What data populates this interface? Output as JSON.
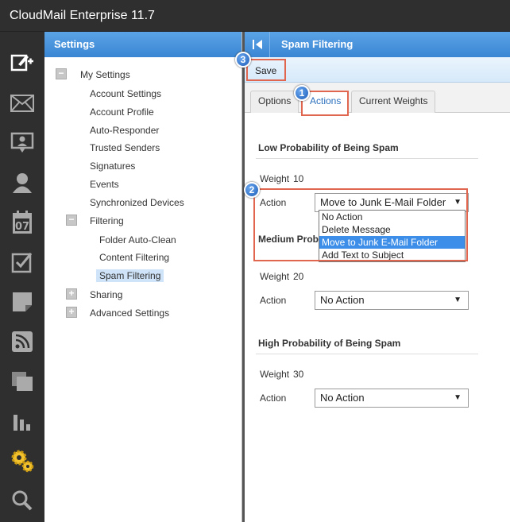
{
  "app": {
    "title": "CloudMail Enterprise 11.7"
  },
  "iconbar": {
    "icons": [
      "compose-icon",
      "mail-icon",
      "contacts-card-icon",
      "user-icon",
      "calendar-icon",
      "tasks-icon",
      "notes-icon",
      "rss-icon",
      "files-icon",
      "reports-icon",
      "settings-gear-icon",
      "search-icon"
    ],
    "calendar_day": "07"
  },
  "settings": {
    "header": "Settings",
    "tree": {
      "my_settings": "My Settings",
      "account_settings": "Account Settings",
      "account_profile": "Account Profile",
      "auto_responder": "Auto-Responder",
      "trusted_senders": "Trusted Senders",
      "signatures": "Signatures",
      "events": "Events",
      "synchronized_devices": "Synchronized Devices",
      "filtering": "Filtering",
      "folder_auto_clean": "Folder Auto-Clean",
      "content_filtering": "Content Filtering",
      "spam_filtering": "Spam Filtering",
      "sharing": "Sharing",
      "advanced_settings": "Advanced Settings",
      "expanded_glyph": "−",
      "collapsed_glyph": "+"
    }
  },
  "main": {
    "title": "Spam Filtering",
    "toolbar": {
      "save_label": "Save"
    },
    "tabs": {
      "options": "Options",
      "actions": "Actions",
      "current_weights": "Current Weights"
    },
    "callouts": {
      "one": "1",
      "two": "2",
      "three": "3"
    },
    "weight_label": "Weight",
    "action_label": "Action",
    "sections": {
      "low": {
        "title": "Low Probability of Being Spam",
        "weight": "10",
        "action": "Move to Junk E-Mail Folder"
      },
      "medium": {
        "title_visible": "Medium Prob",
        "weight": "20",
        "action": "No Action"
      },
      "high": {
        "title": "High Probability of Being Spam",
        "weight": "30",
        "action": "No Action"
      }
    },
    "dropdown_options": [
      "No Action",
      "Delete Message",
      "Move to Junk E-Mail Folder",
      "Add Text to Subject"
    ],
    "dropdown_selected": "Move to Junk E-Mail Folder"
  },
  "colors": {
    "accent_blue": "#3b86d4",
    "highlight_red": "#e0664f",
    "selected_option": "#3d8ee8"
  }
}
